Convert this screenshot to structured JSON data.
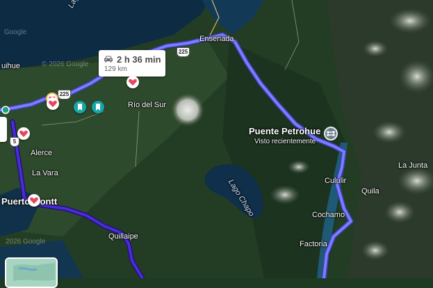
{
  "route": {
    "duration": "2 h 36 min",
    "distance": "129 km",
    "icon": "car-icon",
    "color": "#7b7cff",
    "alt_color": "#4b2bd8"
  },
  "places": {
    "ensenada": "Ensenada",
    "rio_del_sur": "Río del Sur",
    "puente_petrohue": "Puente Petrohue",
    "visto_recientemente": "Visto recientemente",
    "la_junta": "La Junta",
    "culuir": "Cululir",
    "quila": "Quila",
    "cochamo": "Cochamo",
    "factoria": "Factoria",
    "quillaipe": "Quillaipe",
    "alerce": "Alerce",
    "la_vara": "La Vara",
    "puerto_montt": "Puerto Montt",
    "uihue": "uihue"
  },
  "water": {
    "lago_llanquihue": "Lago Ll...",
    "lago_chapo": "Lago Chapo"
  },
  "roads": {
    "r225_a": "225",
    "r225_b": "225",
    "r5": "5"
  },
  "watermarks": {
    "google_top": "Google",
    "copyright_mid": "© 2026 Google",
    "copyright_bottom": "2026 Google"
  },
  "colors": {
    "heart_pin": "#e8475f",
    "bookmark_pin": "#17a5a9",
    "lake": "#0d2c44",
    "poi": "#6d7f8a"
  }
}
